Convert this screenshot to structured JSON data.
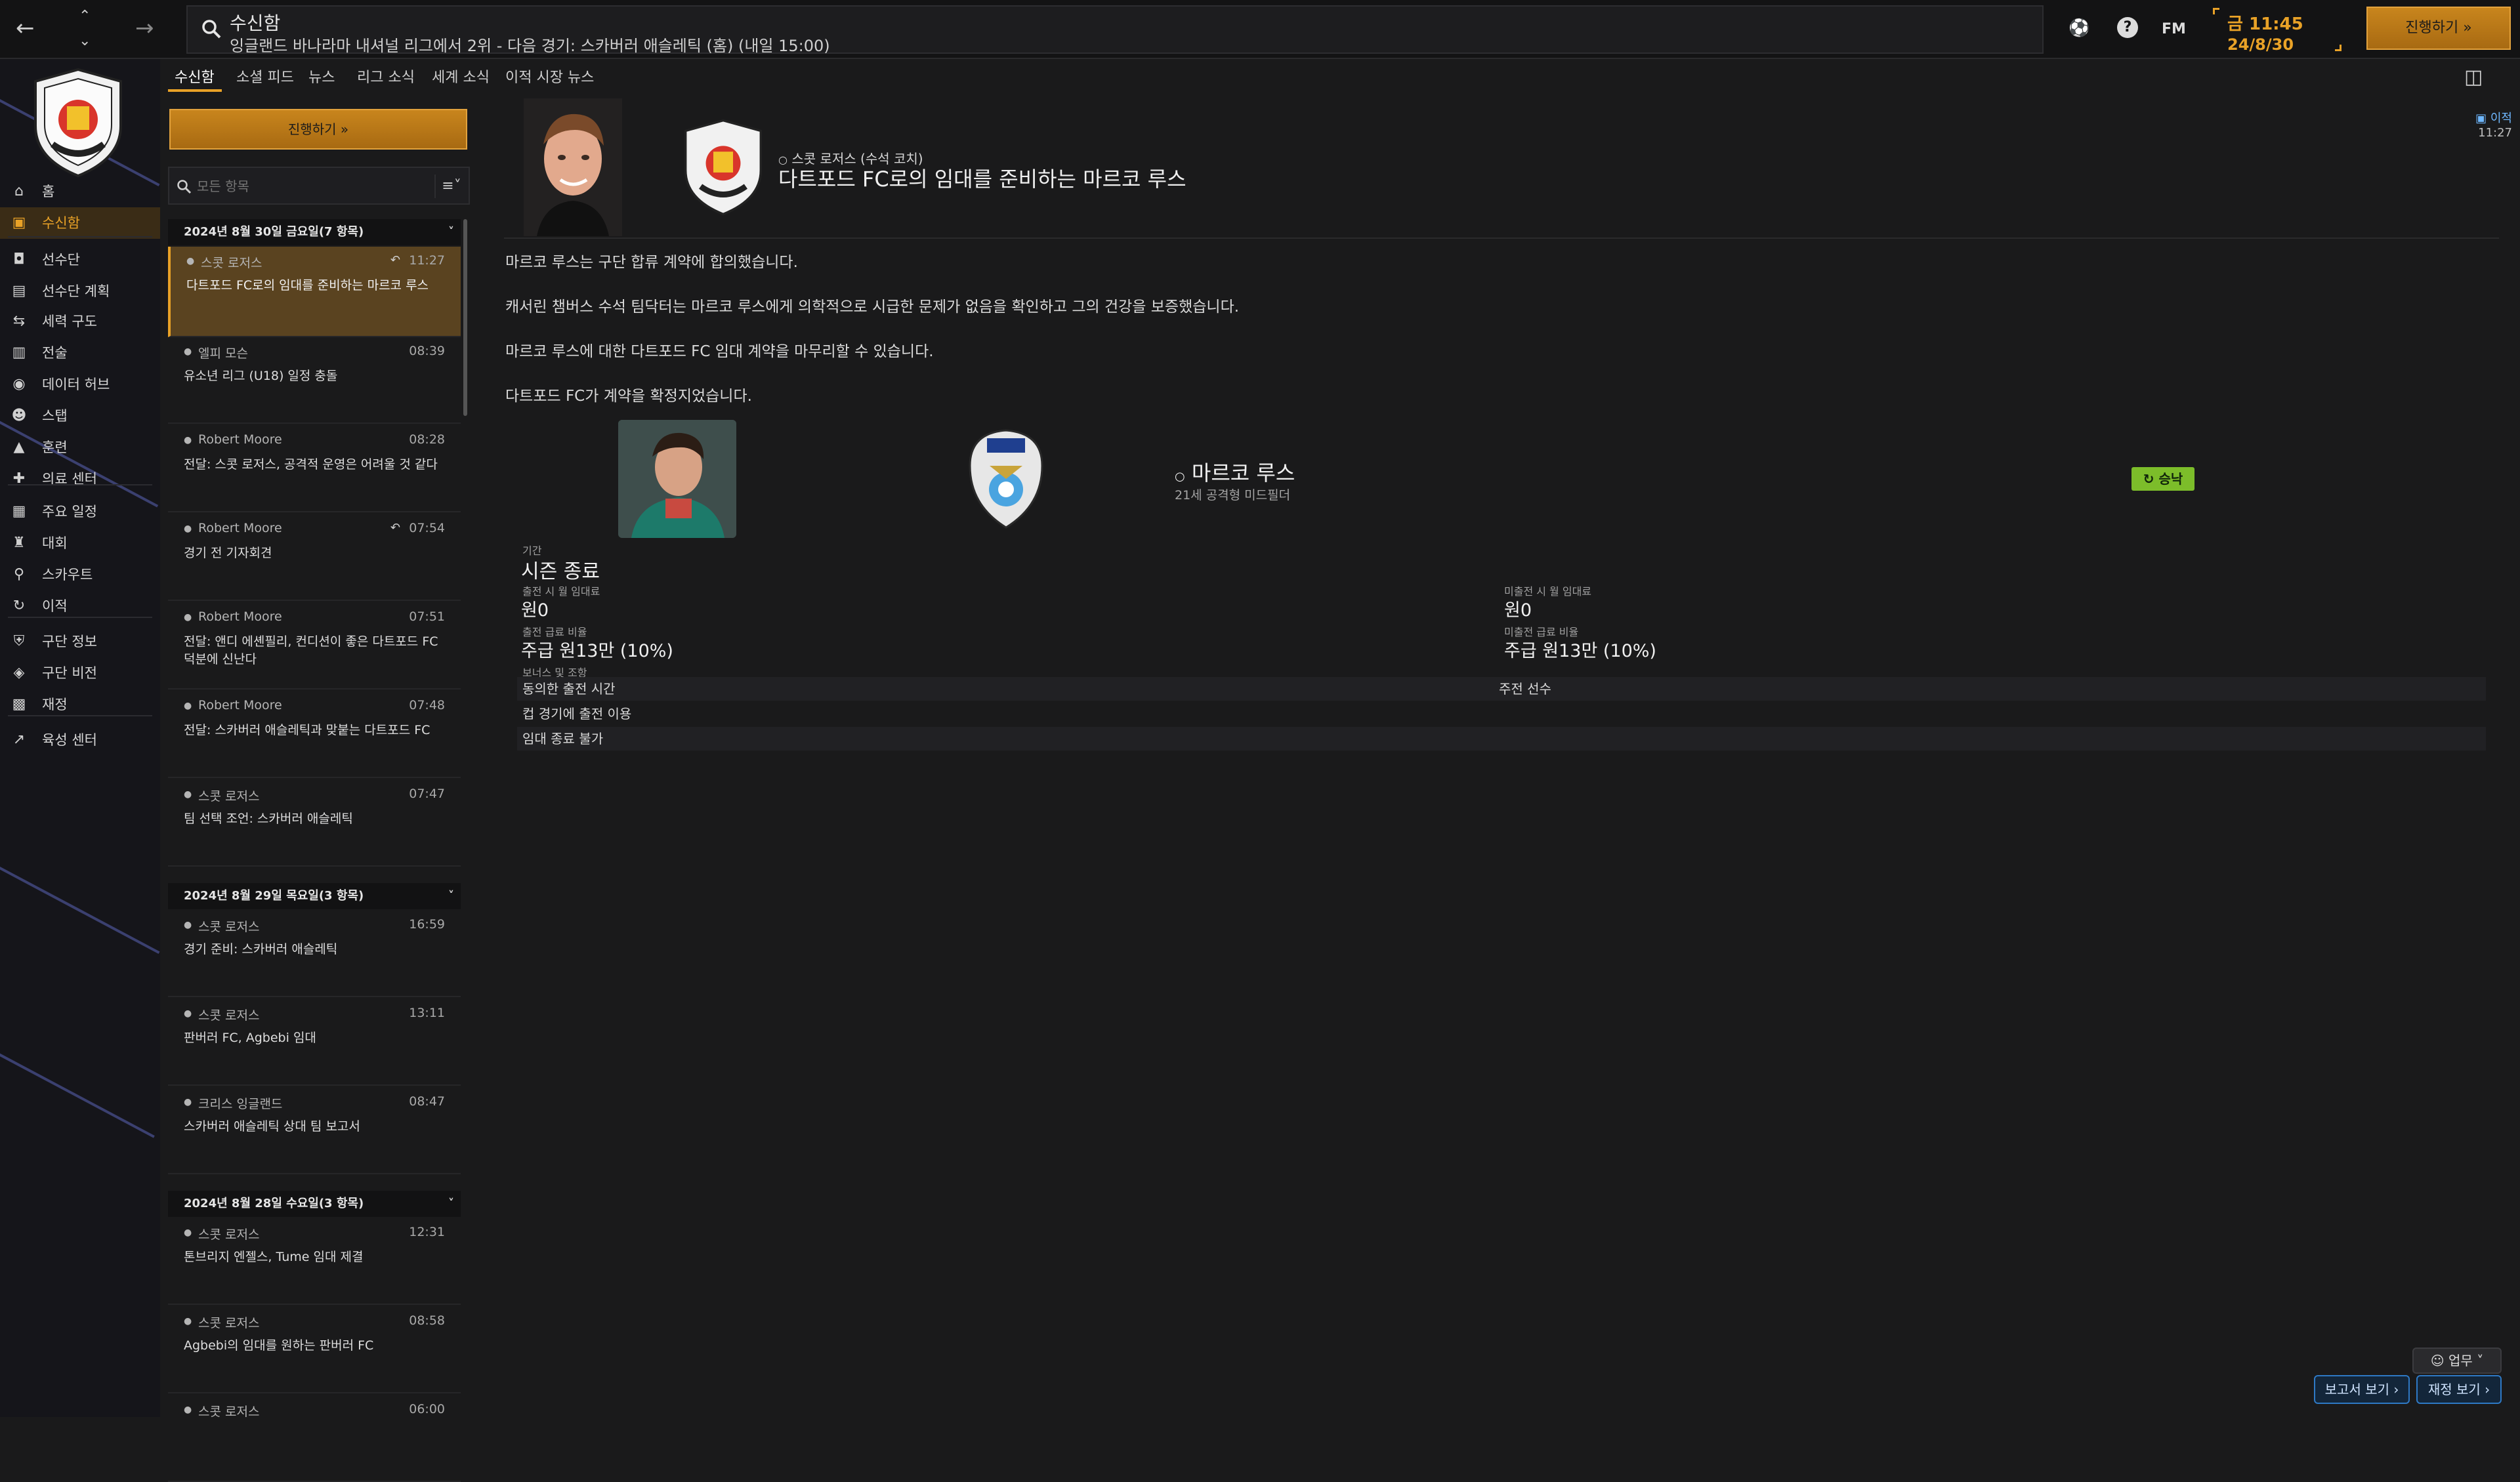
{
  "topbar": {
    "heading": "수신함",
    "subheading": "잉글랜드 바나라마 내셔널 리그에서 2위 - 다음 경기: 스카버러 애슬레틱 (홈) (내일 15:00)",
    "fm_label": "FM",
    "help_label": "?",
    "clock": "금 11:45",
    "date": "24/8/30",
    "continue_label": "진행하기 »"
  },
  "sidebar": {
    "items": [
      {
        "label": "홈",
        "icon": "home-icon"
      },
      {
        "label": "수신함",
        "icon": "inbox-icon"
      },
      {
        "label": "선수단",
        "icon": "shirt-icon"
      },
      {
        "label": "선수단 계획",
        "icon": "clipboard-icon"
      },
      {
        "label": "세력 구도",
        "icon": "dynamics-icon"
      },
      {
        "label": "전술",
        "icon": "tactics-icon"
      },
      {
        "label": "데이터 허브",
        "icon": "data-hub-icon"
      },
      {
        "label": "스탭",
        "icon": "staff-icon"
      },
      {
        "label": "훈련",
        "icon": "training-icon"
      },
      {
        "label": "의료 센터",
        "icon": "medical-icon"
      },
      {
        "label": "주요 일정",
        "icon": "calendar-icon"
      },
      {
        "label": "대회",
        "icon": "trophy-icon"
      },
      {
        "label": "스카우트",
        "icon": "scout-icon"
      },
      {
        "label": "이적",
        "icon": "transfer-icon"
      },
      {
        "label": "구단 정보",
        "icon": "club-shield-icon"
      },
      {
        "label": "구단 비전",
        "icon": "vision-icon"
      },
      {
        "label": "재정",
        "icon": "finance-icon"
      },
      {
        "label": "육성 센터",
        "icon": "development-icon"
      }
    ]
  },
  "tabs": [
    "수신함",
    "소셜 피드",
    "뉴스",
    "리그 소식",
    "세계 소식",
    "이적 시장 뉴스"
  ],
  "list": {
    "continue_label": "진행하기 »",
    "filter_placeholder": "모든 항목",
    "groups": [
      {
        "header": "2024년 8월 30일 금요일(7 항목)",
        "messages": [
          {
            "sender": "스콧 로저스",
            "time": "11:27",
            "subject": "다트포드 FC로의 임대를 준비하는 마르코 루스",
            "replied": true
          },
          {
            "sender": "엘피 모슨",
            "time": "08:39",
            "subject": "유소년 리그 (U18) 일정 충돌",
            "replied": false
          },
          {
            "sender": "Robert Moore",
            "time": "08:28",
            "subject": "전달: 스콧 로저스, 공격적 운영은 어려울 것 같다",
            "replied": false
          },
          {
            "sender": "Robert Moore",
            "time": "07:54",
            "subject": "경기 전 기자회견",
            "replied": true
          },
          {
            "sender": "Robert Moore",
            "time": "07:51",
            "subject": "전달: 앤디 에셴필리, 컨디션이 좋은 다트포드 FC 덕분에 신난다",
            "replied": false
          },
          {
            "sender": "Robert Moore",
            "time": "07:48",
            "subject": "전달: 스카버러 애슬레틱과 맞붙는 다트포드 FC",
            "replied": false
          },
          {
            "sender": "스콧 로저스",
            "time": "07:47",
            "subject": "팀 선택 조언: 스카버러 애슬레틱",
            "replied": false
          }
        ]
      },
      {
        "header": "2024년 8월 29일 목요일(3 항목)",
        "messages": [
          {
            "sender": "스콧 로저스",
            "time": "16:59",
            "subject": "경기 준비: 스카버러 애슬레틱",
            "replied": false
          },
          {
            "sender": "스콧 로저스",
            "time": "13:11",
            "subject": "판버러 FC, Agbebi 임대",
            "replied": false
          },
          {
            "sender": "크리스 잉글랜드",
            "time": "08:47",
            "subject": "스카버러 애슬레틱 상대 팀 보고서",
            "replied": false
          }
        ]
      },
      {
        "header": "2024년 8월 28일 수요일(3 항목)",
        "messages": [
          {
            "sender": "스콧 로저스",
            "time": "12:31",
            "subject": "톤브리지 엔젤스, Tume 임대 제결",
            "replied": false
          },
          {
            "sender": "스콧 로저스",
            "time": "08:58",
            "subject": "Agbebi의 임대를 원하는 판버러 FC",
            "replied": false
          },
          {
            "sender": "스콧 로저스",
            "time": "06:00",
            "subject": "",
            "replied": false
          }
        ]
      }
    ]
  },
  "detail": {
    "from": "스콧 로저스 (수석 코치)",
    "title": "다트포드 FC로의 임대를 준비하는 마르코 루스",
    "tag": "이적",
    "time": "11:27",
    "paragraphs": [
      "마르코 루스는 구단 합류 계약에 합의했습니다.",
      "캐서린 챔버스 수석 팀닥터는 마르코 루스에게 의학적으로 시급한 문제가 없음을 확인하고 그의 건강을 보증했습니다.",
      "마르코 루스에 대한 다트포드 FC 임대 계약을 마무리할 수 있습니다.",
      "다트포드 FC가 계약을 확정지었습니다."
    ],
    "deal": {
      "player_name": "마르코 루스",
      "player_desc": "21세 공격형 미드필더",
      "status": "승낙",
      "period_label": "기간",
      "period_value": "시즌 종료",
      "fee_played_label": "출전 시 월 임대료",
      "fee_played_value": "원0",
      "fee_unplayed_label": "미출전 시 월 임대료",
      "fee_unplayed_value": "원0",
      "wage_played_label": "출전 급료 비율",
      "wage_played_value": "주급 원13만 (10%)",
      "wage_unplayed_label": "미출전 급료 비율",
      "wage_unplayed_value": "주급 원13만 (10%)",
      "bonus_label": "보너스 및 조항",
      "clauses": [
        "동의한 출전 시간",
        "컵 경기에 출전 이용",
        "임대 종료 불가"
      ],
      "clause_right": "주전 선수"
    }
  },
  "bottom": {
    "tasks_label": "업무",
    "report_label": "보고서 보기 ›",
    "finance_label": "재정 보기 ›"
  },
  "colors": {
    "accent": "#e9a227",
    "background": "#1a1a1b",
    "status_green": "#7cbd2a",
    "link_blue": "#2e79c5"
  }
}
